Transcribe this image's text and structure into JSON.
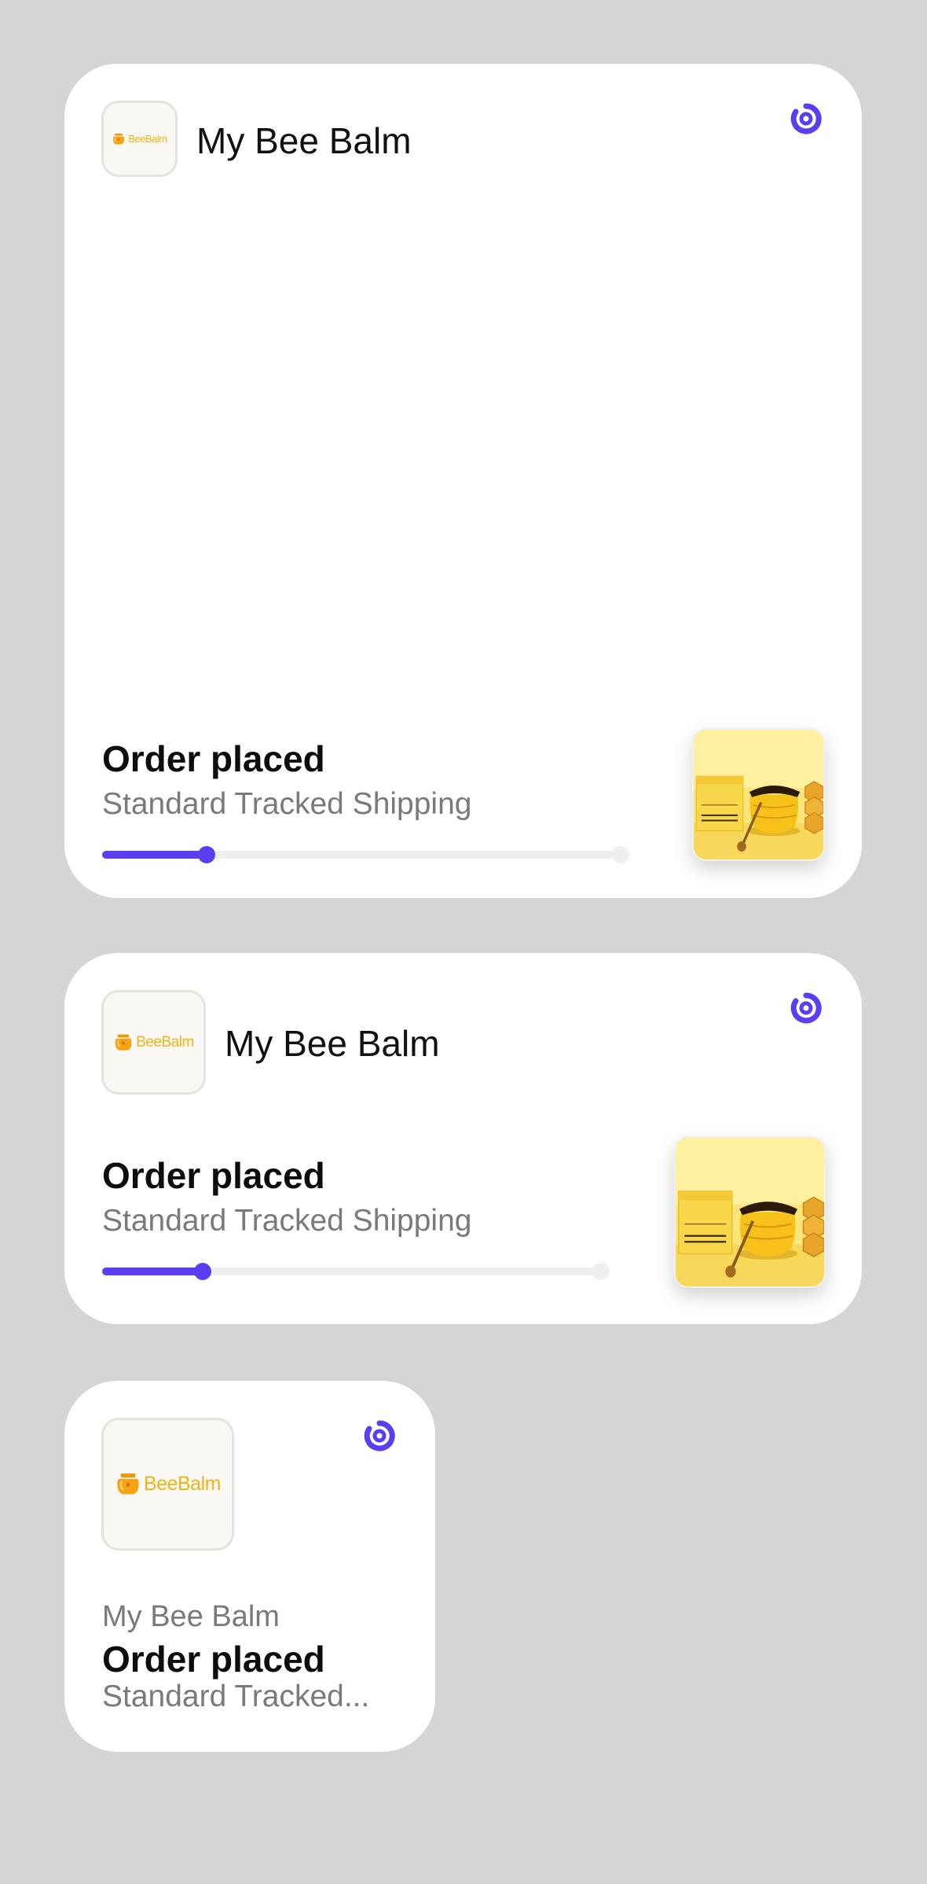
{
  "colors": {
    "background": "#d5d5d5",
    "card": "#ffffff",
    "accent": "#5a3ff0",
    "brand_yellow": "#f2b316",
    "track": "#efefef"
  },
  "logo": {
    "word_part1": "Bee",
    "word_part2": "Balm",
    "icon": "honey-jar-icon"
  },
  "widgets": {
    "large": {
      "store_name": "My Bee Balm",
      "status": "Order placed",
      "shipping": "Standard Tracked Shipping",
      "progress": 0.2,
      "refresh_icon": "refresh-icon",
      "product_image": "bee-balm-product-image"
    },
    "medium": {
      "store_name": "My Bee Balm",
      "status": "Order placed",
      "shipping": "Standard Tracked Shipping",
      "progress": 0.2,
      "refresh_icon": "refresh-icon",
      "product_image": "bee-balm-product-image"
    },
    "small": {
      "store_name": "My Bee Balm",
      "status": "Order placed",
      "shipping": "Standard Tracked...",
      "refresh_icon": "refresh-icon"
    }
  }
}
